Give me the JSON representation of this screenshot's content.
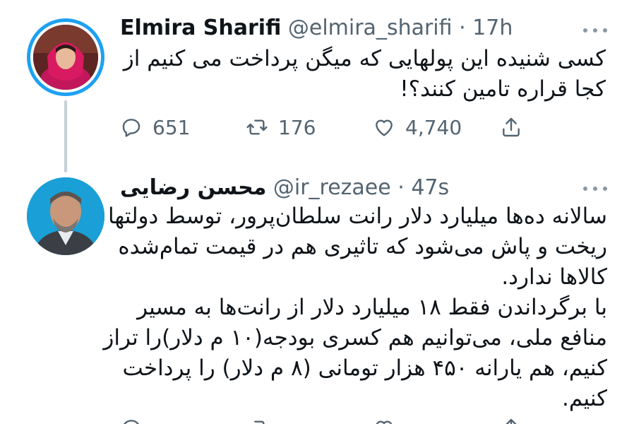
{
  "tweets": [
    {
      "name": "Elmira Sharifi",
      "handle": "@elmira_sharifi",
      "time": "· 17h",
      "text_lines": [
        "کسی شنیده این پولهایی که میگن پرداخت می کنیم از",
        "کجا قراره تامین کنند؟!"
      ],
      "replies": "651",
      "retweets": "176",
      "likes": "4,740"
    },
    {
      "name": "محسن رضایی",
      "handle": "@ir_rezaee",
      "time": "· 47s",
      "text_lines": [
        "سالانه ده‌ها میلیارد دلار رانت سلطان‌پرور، توسط دولتها",
        "ریخت و پاش می‌شود که تاثیری هم در قیمت تمام‌شده",
        "کالاها ندارد.",
        "با برگرداندن فقط ۱۸ میلیارد دلار از رانت‌ها به مسیر",
        "منافع ملی، می‌توانیم هم کسری بودجه(۱۰ م دلار)را تراز",
        "کنیم، هم یارانه ۴۵۰ هزار تومانی (۸ م دلار) را پرداخت",
        "کنیم."
      ]
    }
  ],
  "colors": {
    "accent": "#1da1f2",
    "secondary_text": "#536471",
    "thread_line": "#c4cfd6",
    "icon": "#536471"
  },
  "icons": [
    "reply-icon",
    "retweet-icon",
    "like-icon",
    "share-icon",
    "more-icon"
  ]
}
